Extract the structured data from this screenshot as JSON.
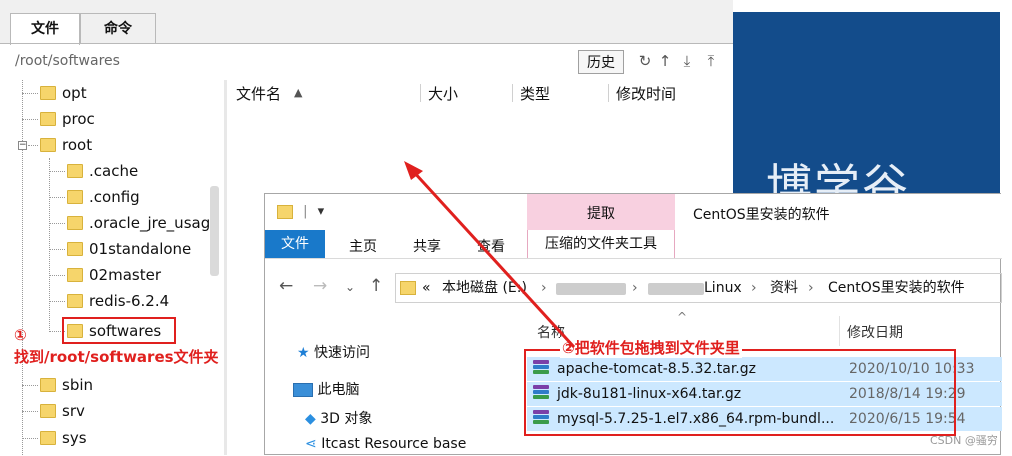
{
  "sftp": {
    "tabs": [
      {
        "label": "文件"
      },
      {
        "label": "命令"
      }
    ],
    "path": "/root/softwares",
    "history_label": "历史",
    "tools": [
      "refresh-icon",
      "up-icon",
      "download-icon",
      "upload-icon"
    ],
    "tree": [
      {
        "label": "opt"
      },
      {
        "label": "proc"
      },
      {
        "label": "root"
      },
      {
        "label": ".cache"
      },
      {
        "label": ".config"
      },
      {
        "label": ".oracle_jre_usage"
      },
      {
        "label": "01standalone"
      },
      {
        "label": "02master"
      },
      {
        "label": "redis-6.2.4"
      },
      {
        "label": "softwares"
      },
      {
        "label": "sbin"
      },
      {
        "label": "srv"
      },
      {
        "label": "sys"
      }
    ],
    "columns": {
      "name": "文件名",
      "size": "大小",
      "type": "类型",
      "modified": "修改时间"
    }
  },
  "background": {
    "text": "博学谷"
  },
  "explorer": {
    "qat_divider": "|",
    "qat_menu": "▾",
    "context_tab": "提取",
    "title": "CentOS里安装的软件",
    "ribbon": {
      "file": "文件",
      "home": "主页",
      "share": "共享",
      "view": "查看",
      "context_sub": "压缩的文件夹工具"
    },
    "breadcrumb": {
      "prefix": "«",
      "drive": "本地磁盘 (E:)",
      "sep": "›",
      "linux_suffix": "Linux",
      "materials": "资料",
      "current": "CentOS里安装的软件"
    },
    "nav_pane": {
      "quick_access": "快速访问",
      "this_pc": "此电脑",
      "objects_3d": "3D 对象",
      "resource": "Itcast Resource base"
    },
    "columns": {
      "name": "名称",
      "modified": "修改日期"
    },
    "files": [
      {
        "name": "apache-tomcat-8.5.32.tar.gz",
        "date": "2020/10/10 10:33"
      },
      {
        "name": "jdk-8u181-linux-x64.tar.gz",
        "date": "2018/8/14 19:29"
      },
      {
        "name": "mysql-5.7.25-1.el7.x86_64.rpm-bundl...",
        "date": "2020/6/15 19:54"
      }
    ]
  },
  "annotations": {
    "step1_marker": "①",
    "step1_text": "找到/root/softwares文件夹",
    "step2_text": "②把软件包拖拽到文件夹里"
  },
  "watermark": "CSDN @骚穷",
  "colors": {
    "annotation": "#e0201e",
    "selection": "#cce8ff",
    "file_tab": "#1979ca",
    "context_tab": "#f8d0e0",
    "background_blue": "#134c8b"
  }
}
